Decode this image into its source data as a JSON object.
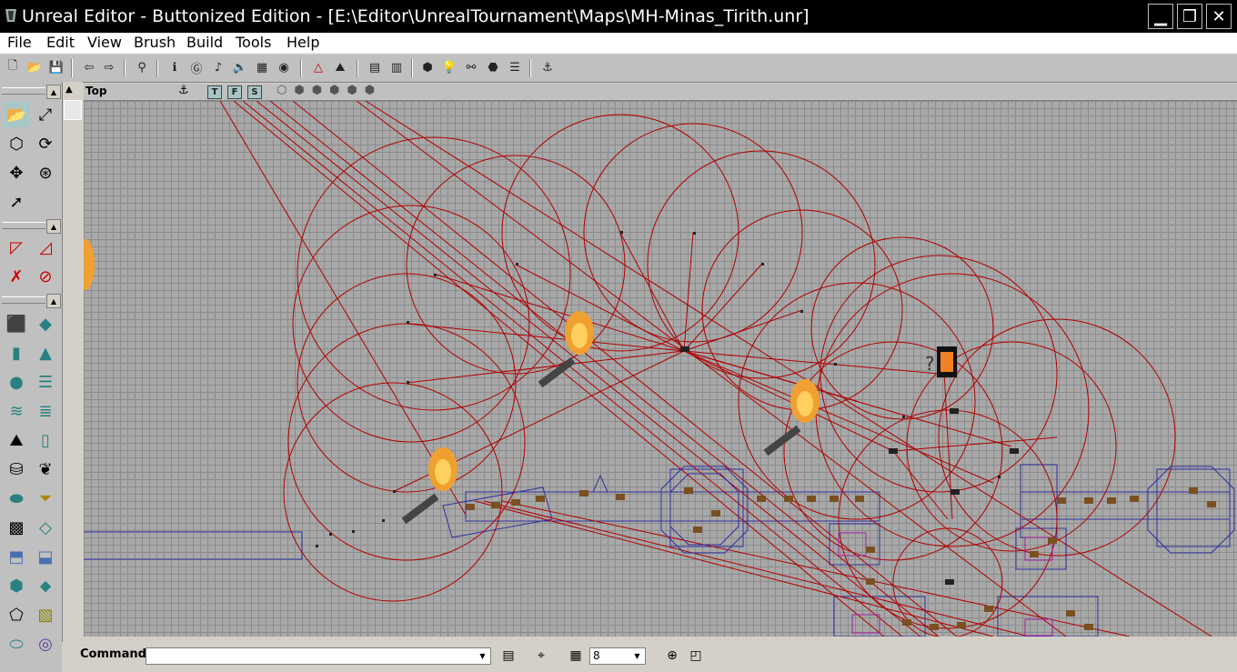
{
  "window": {
    "title": "Unreal Editor - Buttonized Edition - [E:\\Editor\\UnrealTournament\\Maps\\MH-Minas_Tirith.unr]"
  },
  "menu": [
    "File",
    "Edit",
    "View",
    "Brush",
    "Build",
    "Tools",
    "Help"
  ],
  "toolbar": {
    "buttons": [
      "new-map-icon",
      "open-map-icon",
      "save-map-icon",
      "undo-icon",
      "redo-icon",
      "search-actors-icon",
      "actor-properties-icon",
      "group-browser-icon",
      "sound-browser-icon",
      "sound-icon",
      "texture-browser-icon",
      "mesh-viewer-icon",
      "2d-shape-editor-icon",
      "terrain-icon",
      "actor-browser-icon",
      "texture-list-icon",
      "build-geometry-icon",
      "build-lighting-icon",
      "build-paths-icon",
      "build-all-icon",
      "build-options-icon",
      "play-level-icon"
    ]
  },
  "viewport": {
    "label": "Top",
    "toggles": [
      "T",
      "F",
      "S"
    ]
  },
  "statusbar": {
    "command_label": "Command",
    "command_value": "",
    "grid_size": "8"
  },
  "colors": {
    "grid_bg": "#a8a8a8",
    "grid_line": "#8c8c8c",
    "radius_circle": "#b00000",
    "brush_line": "#3030a0"
  }
}
